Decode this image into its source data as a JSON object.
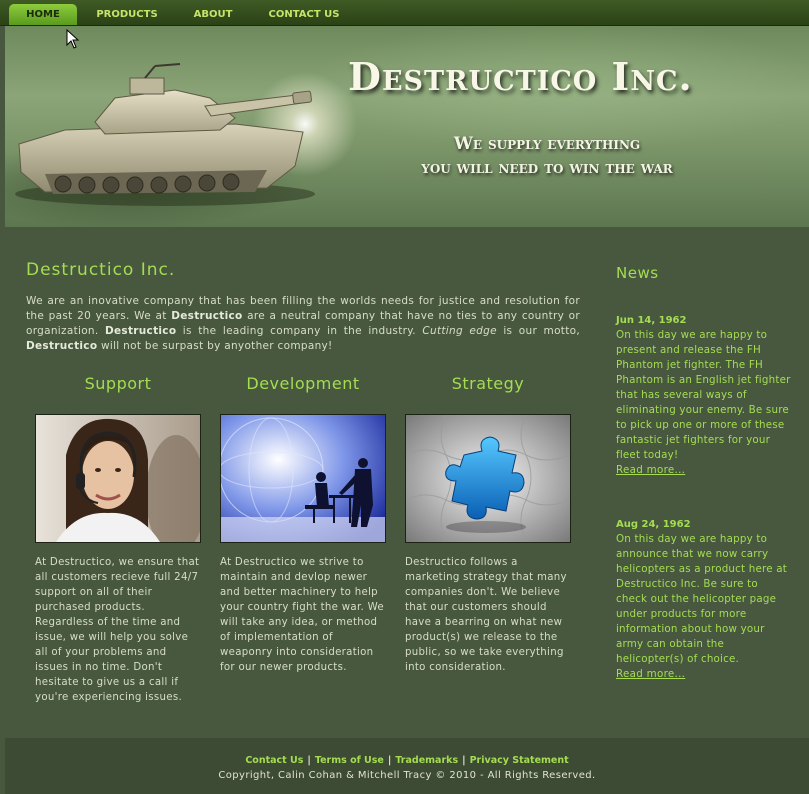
{
  "nav": {
    "items": [
      {
        "label": "HOME",
        "active": true
      },
      {
        "label": "PRODUCTS",
        "active": false
      },
      {
        "label": "ABOUT",
        "active": false
      },
      {
        "label": "CONTACT US",
        "active": false
      }
    ]
  },
  "banner": {
    "title": "Destructico Inc.",
    "tagline_line1": "We supply everything",
    "tagline_line2": "you will need to win the war"
  },
  "main": {
    "title": "Destructico Inc.",
    "intro": {
      "part1": "We are an inovative company that has been filling the worlds needs for justice and resolution for the past 20 years. We at ",
      "brand": "Destructico",
      "part2": " are a neutral company that have no ties to any country or organization. ",
      "part3": " is the leading company in the industry. ",
      "motto": "Cutting edge",
      "part4": " is our motto, ",
      "part5": " will not be surpast by anyother company!"
    },
    "columns": [
      {
        "heading": "Support",
        "image": "customer-support-agent-photo",
        "text": "At Destructico, we ensure that all customers recieve full 24/7 support on all of their purchased products. Regardless of the time and issue, we will help you solve all of your problems and issues in no time. Don't hesitate to give us a call if you're experiencing issues."
      },
      {
        "heading": "Development",
        "image": "globe-business-handshake-photo",
        "text": "At Destructico we strive to maintain and devlop newer and better machinery to help your country fight the war. We will take any idea, or method of implementation of weaponry into consideration for our newer products."
      },
      {
        "heading": "Strategy",
        "image": "blue-puzzle-piece-photo",
        "text": "Destructico follows a marketing strategy that many companies don't. We believe that our customers should have a bearring on what new product(s) we release to the public, so we take everything into consideration."
      }
    ]
  },
  "news": {
    "title": "News",
    "items": [
      {
        "date": "Jun 14, 1962",
        "text": "On this day we are happy to present and release the FH Phantom jet fighter. The FH Phantom is an English jet fighter that has several ways of eliminating your enemy. Be sure to pick up one or more of these fantastic jet fighters for your fleet today!",
        "link": "Read more..."
      },
      {
        "date": "Aug 24, 1962",
        "text": "On this day we are happy to announce that we now carry helicopters as a product here at Destructico Inc. Be sure to check out the helicopter page under products for more information about how your army can obtain the helicopter(s) of choice.",
        "link": "Read more..."
      }
    ]
  },
  "footer": {
    "links": [
      "Contact Us",
      "Terms of Use",
      "Trademarks",
      "Privacy Statement"
    ],
    "separator": "|",
    "copyright": "Copyright, Calin Cohan & Mitchell Tracy © 2010 - All Rights Reserved."
  },
  "colors": {
    "background": "#48583f",
    "accent_green": "#a4dd52",
    "body_text": "#d8ddc8",
    "footer_bg": "#3d4a34",
    "nav_bg": "#2b4216"
  }
}
